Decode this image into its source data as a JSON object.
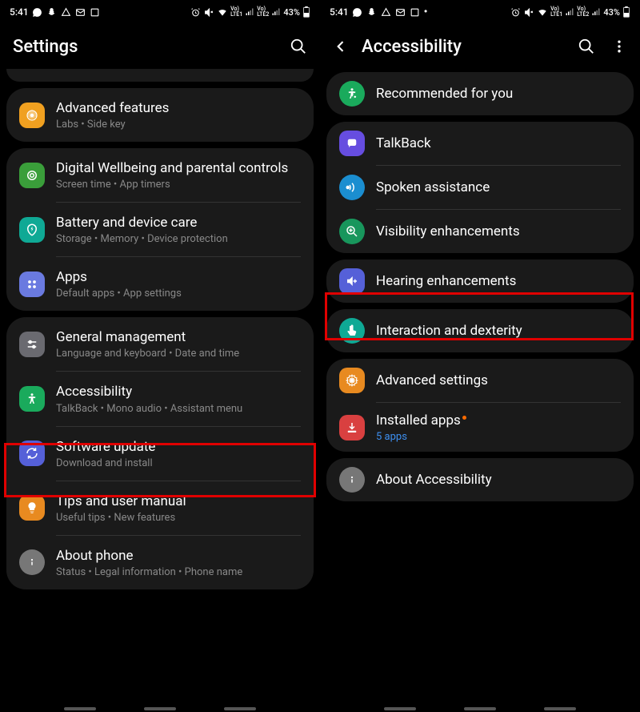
{
  "status": {
    "time": "5:41",
    "battery": "43%"
  },
  "left": {
    "title": "Settings",
    "sections": [
      {
        "items": [
          {
            "title": "Advanced features",
            "sub": "Labs • Side key",
            "iconBg": "#f0a020",
            "iconName": "gear-plus-icon"
          }
        ]
      },
      {
        "items": [
          {
            "title": "Digital Wellbeing and parental controls",
            "sub": "Screen time • App timers",
            "iconBg": "#3a9e3a",
            "iconName": "wellbeing-icon"
          },
          {
            "title": "Battery and device care",
            "sub": "Storage • Memory • Device protection",
            "iconBg": "#0fa995",
            "iconName": "battery-care-icon"
          },
          {
            "title": "Apps",
            "sub": "Default apps • App settings",
            "iconBg": "#6a7ae0",
            "iconName": "apps-grid-icon"
          }
        ]
      },
      {
        "items": [
          {
            "title": "General management",
            "sub": "Language and keyboard • Date and time",
            "iconBg": "#6a6a70",
            "iconName": "sliders-icon"
          },
          {
            "title": "Accessibility",
            "sub": "TalkBack • Mono audio • Assistant menu",
            "iconBg": "#1aaa5c",
            "iconName": "accessibility-icon"
          },
          {
            "title": "Software update",
            "sub": "Download and install",
            "iconBg": "#5560d8",
            "iconName": "update-icon"
          },
          {
            "title": "Tips and user manual",
            "sub": "Useful tips • New features",
            "iconBg": "#e88a20",
            "iconName": "bulb-icon"
          },
          {
            "title": "About phone",
            "sub": "Status • Legal information • Phone name",
            "iconBg": "#777",
            "iconName": "info-icon"
          }
        ]
      }
    ]
  },
  "right": {
    "title": "Accessibility",
    "sections": [
      {
        "items": [
          {
            "title": "Recommended for you",
            "iconBg": "#1aaa5c",
            "iconName": "accessibility-heart-icon"
          }
        ]
      },
      {
        "items": [
          {
            "title": "TalkBack",
            "iconBg": "#664de0",
            "iconName": "talkback-icon"
          },
          {
            "title": "Spoken assistance",
            "iconBg": "#1b8ed0",
            "iconName": "sound-wave-icon"
          },
          {
            "title": "Visibility enhancements",
            "iconBg": "#18965c",
            "iconName": "zoom-plus-icon"
          }
        ]
      },
      {
        "items": [
          {
            "title": "Hearing enhancements",
            "iconBg": "#5560d8",
            "iconName": "volume-plus-icon"
          }
        ]
      },
      {
        "items": [
          {
            "title": "Interaction and dexterity",
            "iconBg": "#0fa995",
            "iconName": "touch-icon"
          }
        ]
      },
      {
        "items": [
          {
            "title": "Advanced settings",
            "iconBg": "#e88a20",
            "iconName": "gear-icon"
          },
          {
            "title": "Installed apps",
            "sub": "5 apps",
            "subLink": true,
            "badge": true,
            "iconBg": "#d94040",
            "iconName": "download-icon"
          }
        ]
      },
      {
        "items": [
          {
            "title": "About Accessibility",
            "iconBg": "#777",
            "iconName": "info-icon"
          }
        ]
      }
    ]
  }
}
